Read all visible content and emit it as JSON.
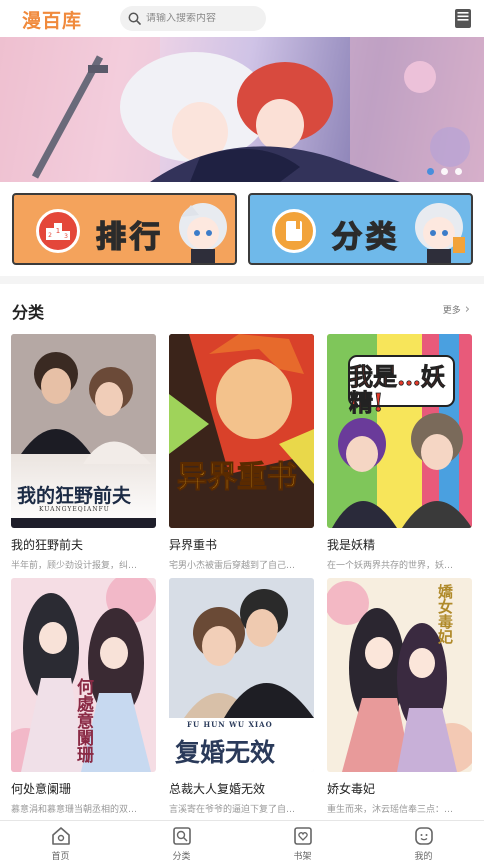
{
  "header": {
    "logo": "漫百库",
    "search_placeholder": "请输入搜索内容",
    "shelf_icon": "book-icon"
  },
  "banner": {
    "dot_count": 3,
    "active_dot": 1
  },
  "entries": [
    {
      "label": "排行",
      "icon": "ranking-podium-icon",
      "color": "#f4a35c"
    },
    {
      "label": "分类",
      "icon": "category-book-icon",
      "color": "#6fb9ea"
    }
  ],
  "section": {
    "title": "分类",
    "more_label": "更多"
  },
  "comics": [
    {
      "title": "我的狂野前夫",
      "desc": "半年前，顾少劲设计报复，纠…",
      "cover_text": "我的狂野前夫",
      "cover_sub": "KUANGYEQIANFU"
    },
    {
      "title": "异界重书",
      "desc": "宅男小杰被雷后穿越到了自己…",
      "cover_text": "异界重书"
    },
    {
      "title": "我是妖精",
      "desc": "在一个妖两界共存的世界，妖…",
      "cover_text": "我是…妖精!"
    },
    {
      "title": "何处意阑珊",
      "desc": "慕意涓和慕意珊当朝丞相的双…",
      "cover_text": "何處意闌珊"
    },
    {
      "title": "总裁大人复婚无效",
      "desc": "言溪寄在爷爷的逼迫下复了自…",
      "cover_text": "复婚无效",
      "cover_sub": "FU  HUN  WU  XIAO"
    },
    {
      "title": "娇女毒妃",
      "desc": "重生而来，沐云瑶信奉三点：…",
      "cover_text": "嬌女毒妃"
    }
  ],
  "tabbar": [
    {
      "label": "首页",
      "icon": "home-icon"
    },
    {
      "label": "分类",
      "icon": "category-icon"
    },
    {
      "label": "书架",
      "icon": "bookshelf-icon"
    },
    {
      "label": "我的",
      "icon": "profile-face-icon"
    }
  ]
}
